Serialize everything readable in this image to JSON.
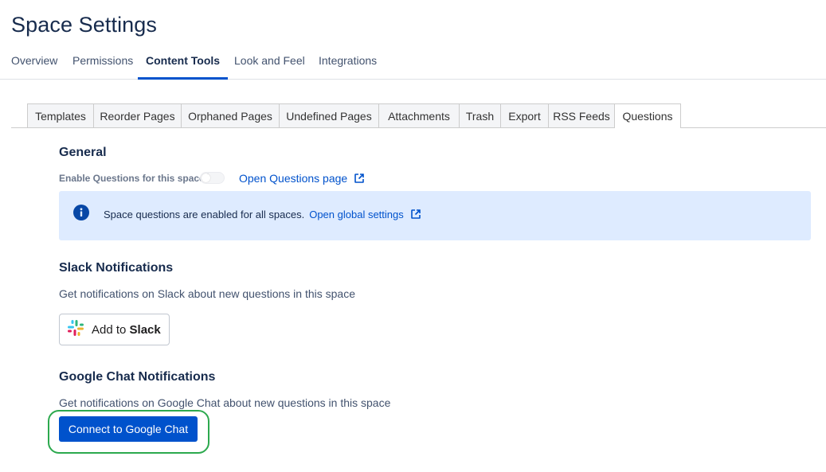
{
  "page": {
    "title": "Space Settings"
  },
  "main_tabs": [
    {
      "label": "Overview"
    },
    {
      "label": "Permissions"
    },
    {
      "label": "Content Tools",
      "active": true
    },
    {
      "label": "Look and Feel"
    },
    {
      "label": "Integrations"
    }
  ],
  "sub_tabs": [
    {
      "label": "Templates"
    },
    {
      "label": "Reorder Pages"
    },
    {
      "label": "Orphaned Pages"
    },
    {
      "label": "Undefined Pages"
    },
    {
      "label": "Attachments"
    },
    {
      "label": "Trash"
    },
    {
      "label": "Export"
    },
    {
      "label": "RSS Feeds"
    },
    {
      "label": "Questions",
      "active": true
    }
  ],
  "general": {
    "title": "General",
    "toggle_label": "Enable Questions for this space",
    "toggle_on": true,
    "toggle_disabled": true,
    "open_page_link": "Open Questions page"
  },
  "info": {
    "text": "Space questions are enabled for all spaces.",
    "link": "Open global settings"
  },
  "slack": {
    "title": "Slack Notifications",
    "description": "Get notifications on Slack about new questions in this space",
    "button_prefix": "Add to",
    "button_brand": "Slack"
  },
  "google_chat": {
    "title": "Google Chat Notifications",
    "description": "Get notifications on Google Chat about new questions in this space",
    "button_label": "Connect to Google Chat"
  },
  "colors": {
    "primary": "#0052cc",
    "info_background": "#deebff",
    "highlight": "#2ca94e"
  }
}
